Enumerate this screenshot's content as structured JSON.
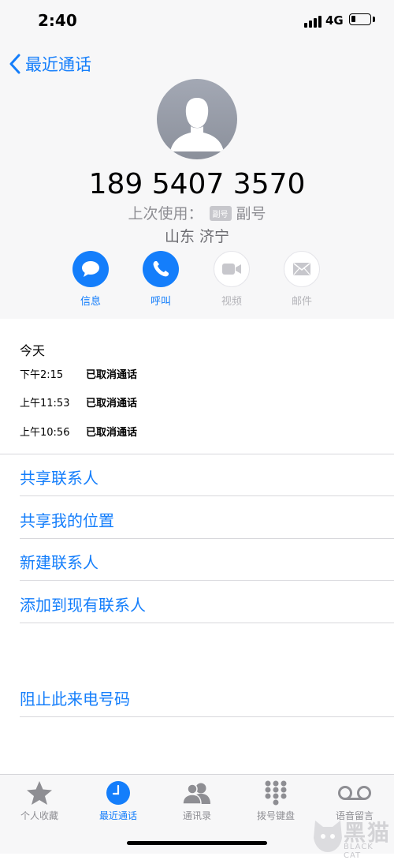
{
  "status_bar": {
    "time": "2:40",
    "network": "4G"
  },
  "nav": {
    "back_label": "最近通话"
  },
  "contact": {
    "number": "189 5407 3570",
    "last_used_prefix": "上次使用：",
    "last_used_badge": "副号",
    "last_used_line": "副号",
    "location": "山东 济宁"
  },
  "actions": [
    {
      "label": "信息",
      "icon": "message-icon",
      "enabled": true
    },
    {
      "label": "呼叫",
      "icon": "phone-icon",
      "enabled": true
    },
    {
      "label": "视频",
      "icon": "video-icon",
      "enabled": false
    },
    {
      "label": "邮件",
      "icon": "mail-icon",
      "enabled": false
    }
  ],
  "history": {
    "day": "今天",
    "calls": [
      {
        "time": "下午2:15",
        "status": "已取消通话"
      },
      {
        "time": "上午11:53",
        "status": "已取消通话"
      },
      {
        "time": "上午10:56",
        "status": "已取消通话"
      }
    ]
  },
  "options": [
    "共享联系人",
    "共享我的位置",
    "新建联系人",
    "添加到现有联系人"
  ],
  "block": "阻止此来电号码",
  "tabs": [
    {
      "label": "个人收藏",
      "icon": "star-icon",
      "active": false
    },
    {
      "label": "最近通话",
      "icon": "clock-icon",
      "active": true
    },
    {
      "label": "通讯录",
      "icon": "contacts-icon",
      "active": false
    },
    {
      "label": "拨号键盘",
      "icon": "keypad-icon",
      "active": false
    },
    {
      "label": "语音留言",
      "icon": "voicemail-icon",
      "active": false
    }
  ],
  "watermark": {
    "text": "黑猫",
    "sub": "BLACK CAT"
  },
  "colors": {
    "accent": "#147efb",
    "disabled": "#b4b4b9",
    "secondary_text": "#8e8e93"
  }
}
